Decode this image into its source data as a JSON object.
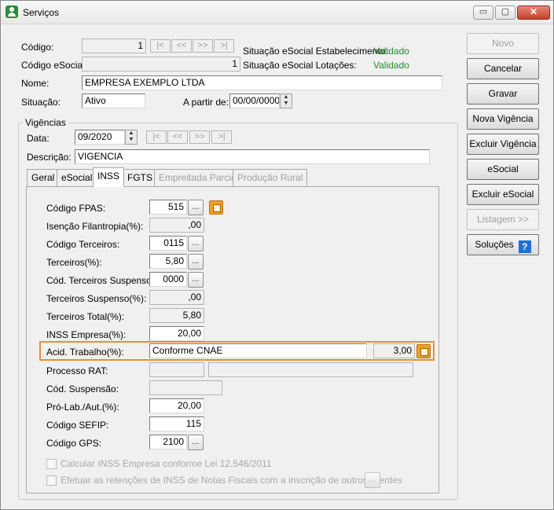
{
  "window": {
    "title": "Serviços",
    "controls": {
      "minimize": "▭",
      "maximize": "▢",
      "close": "✕"
    }
  },
  "header": {
    "codigo_label": "Código:",
    "codigo_value": "1",
    "codigo_esocial_label": "Código eSocial:",
    "codigo_esocial_value": "1",
    "nome_label": "Nome:",
    "nome_value": "EMPRESA EXEMPLO LTDA",
    "situacao_label": "Situação:",
    "situacao_value": "Ativo",
    "apartir_label": "A partir de:",
    "apartir_value": "00/00/0000",
    "sit_estab_label": "Situação eSocial Estabelecimento:",
    "sit_estab_value": "Validado",
    "sit_lot_label": "Situação eSocial Lotações:",
    "sit_lot_value": "Validado",
    "nav": [
      "|<",
      "<<",
      ">>",
      ">|"
    ]
  },
  "vigencias": {
    "group_title": "Vigências",
    "data_label": "Data:",
    "data_value": "09/2020",
    "descricao_label": "Descrição:",
    "descricao_value": "VIGENCIA",
    "nav": [
      "|<",
      "<<",
      ">>",
      ">|"
    ]
  },
  "tabs": [
    {
      "label": "Geral",
      "state": "normal"
    },
    {
      "label": "eSocial",
      "state": "normal"
    },
    {
      "label": "INSS",
      "state": "active"
    },
    {
      "label": "FGTS",
      "state": "normal"
    },
    {
      "label": "Empreitada Parcial",
      "state": "disabled"
    },
    {
      "label": "Produção Rural",
      "state": "disabled"
    }
  ],
  "inss": {
    "codigo_fpas_label": "Código FPAS:",
    "codigo_fpas_value": "515",
    "isencao_label": "Isenção Filantropia(%):",
    "isencao_value": ",00",
    "codigo_terceiros_label": "Código Terceiros:",
    "codigo_terceiros_value": "0115",
    "terceiros_label": "Terceiros(%):",
    "terceiros_value": "5,80",
    "cod_terc_susp_label": "Cód. Terceiros Suspenso:",
    "cod_terc_susp_value": "0000",
    "terc_susp_label": "Terceiros Suspenso(%):",
    "terc_susp_value": ",00",
    "terc_total_label": "Terceiros Total(%):",
    "terc_total_value": "5,80",
    "inss_empresa_label": "INSS Empresa(%):",
    "inss_empresa_value": "20,00",
    "acid_trabalho_label": "Acid. Trabalho(%):",
    "acid_trabalho_option": "Conforme CNAE",
    "acid_trabalho_value": "3,00",
    "processo_rat_label": "Processo RAT:",
    "processo_rat_value": "",
    "cod_suspensao_label": "Cód. Suspensão:",
    "cod_suspensao_value": "",
    "pro_lab_label": "Pró-Lab./Aut.(%):",
    "pro_lab_value": "20,00",
    "codigo_sefip_label": "Código SEFIP:",
    "codigo_sefip_value": "115",
    "codigo_gps_label": "Código GPS:",
    "codigo_gps_value": "2100",
    "chk_lei_label": "Calcular INSS Empresa conforme Lei 12.546/2011",
    "chk_retencoes_label": "Efetuar as retenções de INSS de Notas Fiscais com a inscrição de outros clientes",
    "dots": "..."
  },
  "actions": {
    "novo": "Novo",
    "cancelar": "Cancelar",
    "gravar": "Gravar",
    "nova_vigencia": "Nova Vigência",
    "excluir_vigencia": "Excluir Vigência",
    "esocial": "eSocial",
    "excluir_esocial": "Excluir eSocial",
    "listagem": "Listagem >>",
    "solucoes": "Soluções",
    "help": "?"
  },
  "colors": {
    "highlight": "#e8922a",
    "status_ok": "#1c8f28",
    "help_blue": "#1f6fd1"
  }
}
